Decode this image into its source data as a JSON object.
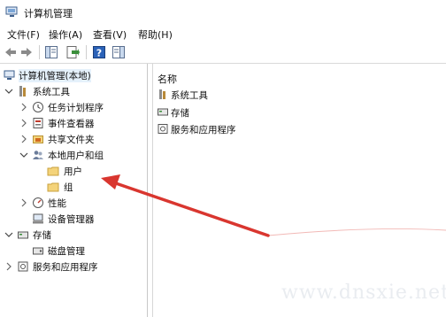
{
  "window": {
    "title": "计算机管理"
  },
  "menu": [
    "文件(F)",
    "操作(A)",
    "查看(V)",
    "帮助(H)"
  ],
  "tree": [
    {
      "label": "计算机管理(本地)",
      "icon": "computer-management-icon",
      "expander": "none",
      "selected": true
    },
    {
      "label": "系统工具",
      "icon": "system-tools-icon",
      "expander": "expanded"
    },
    {
      "label": "任务计划程序",
      "icon": "clock-icon",
      "expander": "collapsed"
    },
    {
      "label": "事件查看器",
      "icon": "event-viewer-icon",
      "expander": "collapsed"
    },
    {
      "label": "共享文件夹",
      "icon": "shared-folder-icon",
      "expander": "collapsed"
    },
    {
      "label": "本地用户和组",
      "icon": "users-icon",
      "expander": "expanded"
    },
    {
      "label": "用户",
      "icon": "folder-icon",
      "expander": "none"
    },
    {
      "label": "组",
      "icon": "folder-icon",
      "expander": "none"
    },
    {
      "label": "性能",
      "icon": "performance-icon",
      "expander": "collapsed"
    },
    {
      "label": "设备管理器",
      "icon": "device-manager-icon",
      "expander": "none"
    },
    {
      "label": "存储",
      "icon": "storage-icon",
      "expander": "expanded"
    },
    {
      "label": "磁盘管理",
      "icon": "disk-management-icon",
      "expander": "none"
    },
    {
      "label": "服务和应用程序",
      "icon": "services-icon",
      "expander": "collapsed"
    }
  ],
  "list": {
    "header": "名称",
    "items": [
      {
        "label": "系统工具",
        "icon": "system-tools-icon"
      },
      {
        "label": "存储",
        "icon": "storage-icon"
      },
      {
        "label": "服务和应用程序",
        "icon": "services-icon"
      }
    ]
  },
  "watermark": "www.dnsxie.net",
  "colors": {
    "arrow": "#d9362f",
    "selection": "#e5f1fb",
    "folder": "#f4d37a"
  }
}
